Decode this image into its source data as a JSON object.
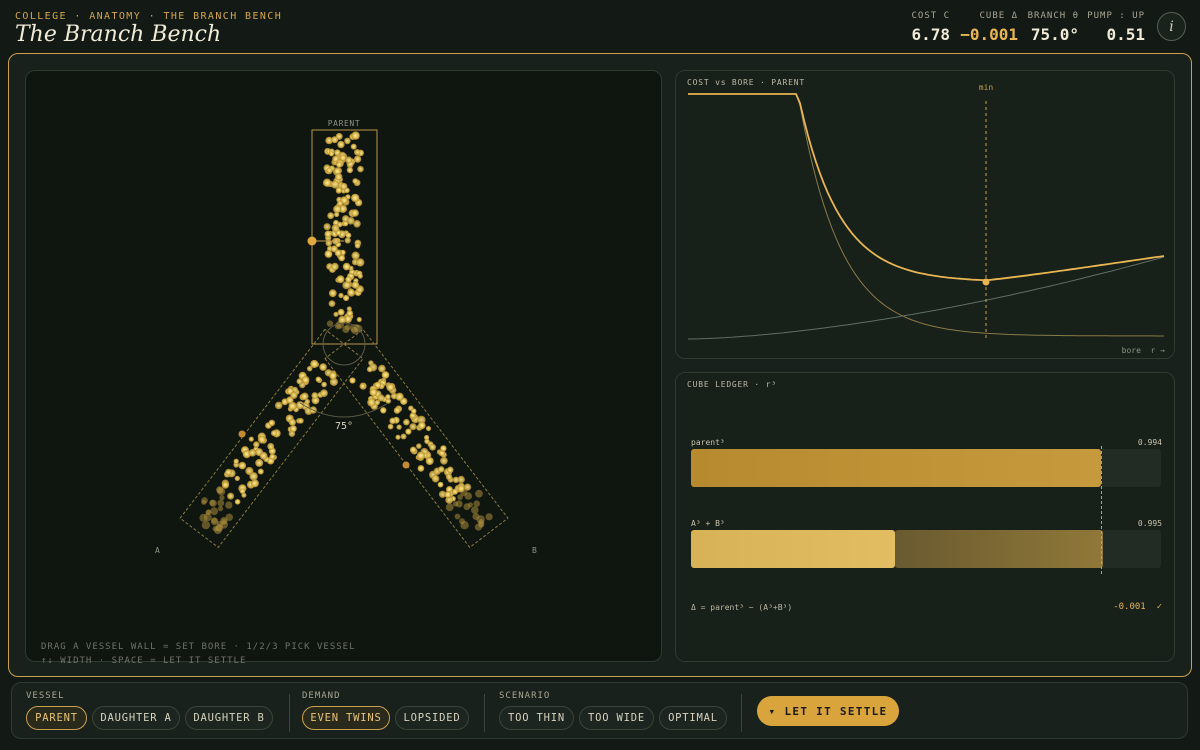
{
  "header": {
    "breadcrumb": "COLLEGE · ANATOMY · THE BRANCH BENCH",
    "title": "The Branch Bench",
    "stats": [
      {
        "label": "COST C",
        "value": "6.78"
      },
      {
        "label": "CUBE Δ",
        "value": "−0.001"
      },
      {
        "label": "BRANCH θ",
        "value": "75.0°"
      },
      {
        "label": "PUMP : UP",
        "value": "0.51"
      }
    ],
    "info_icon": "i"
  },
  "bench": {
    "parent_label": "PARENT",
    "daughter_a_label": "A",
    "daughter_b_label": "B",
    "angle_label": "75°",
    "branch_angle_deg": 75,
    "hint_line1": "DRAG A VESSEL WALL = SET BORE · 1/2/3 PICK VESSEL",
    "hint_line2": "↑↓ WIDTH · SPACE = LET IT SETTLE"
  },
  "cost_chart": {
    "title": "COST vs BORE · PARENT",
    "min_label": "min",
    "axis_label": "bore  r →"
  },
  "ledger": {
    "title": "CUBE LEDGER · r³",
    "rows": [
      {
        "label": "parent³",
        "value": "0.994",
        "fraction": 0.994
      },
      {
        "label": "A³ + B³",
        "value": "0.995",
        "fraction_a": 0.497,
        "fraction_b": 0.498
      }
    ],
    "delta_label": "Δ = parent³ − (A³+B³)",
    "delta_value": "-0.001  ✓"
  },
  "toolbar": {
    "vessel_label": "VESSEL",
    "vessel_options": [
      "PARENT",
      "DAUGHTER A",
      "DAUGHTER B"
    ],
    "demand_label": "DEMAND",
    "demand_options": [
      "EVEN TWINS",
      "LOPSIDED"
    ],
    "scenario_label": "SCENARIO",
    "scenario_options": [
      "TOO THIN",
      "TOO WIDE",
      "OPTIMAL"
    ],
    "settle_label": "LET IT SETTLE",
    "settle_icon": "▾"
  },
  "colors": {
    "accent": "#d9a43c",
    "frame": "#c9a04c",
    "background": "#131a15",
    "cube_delta": "#e8b552"
  }
}
